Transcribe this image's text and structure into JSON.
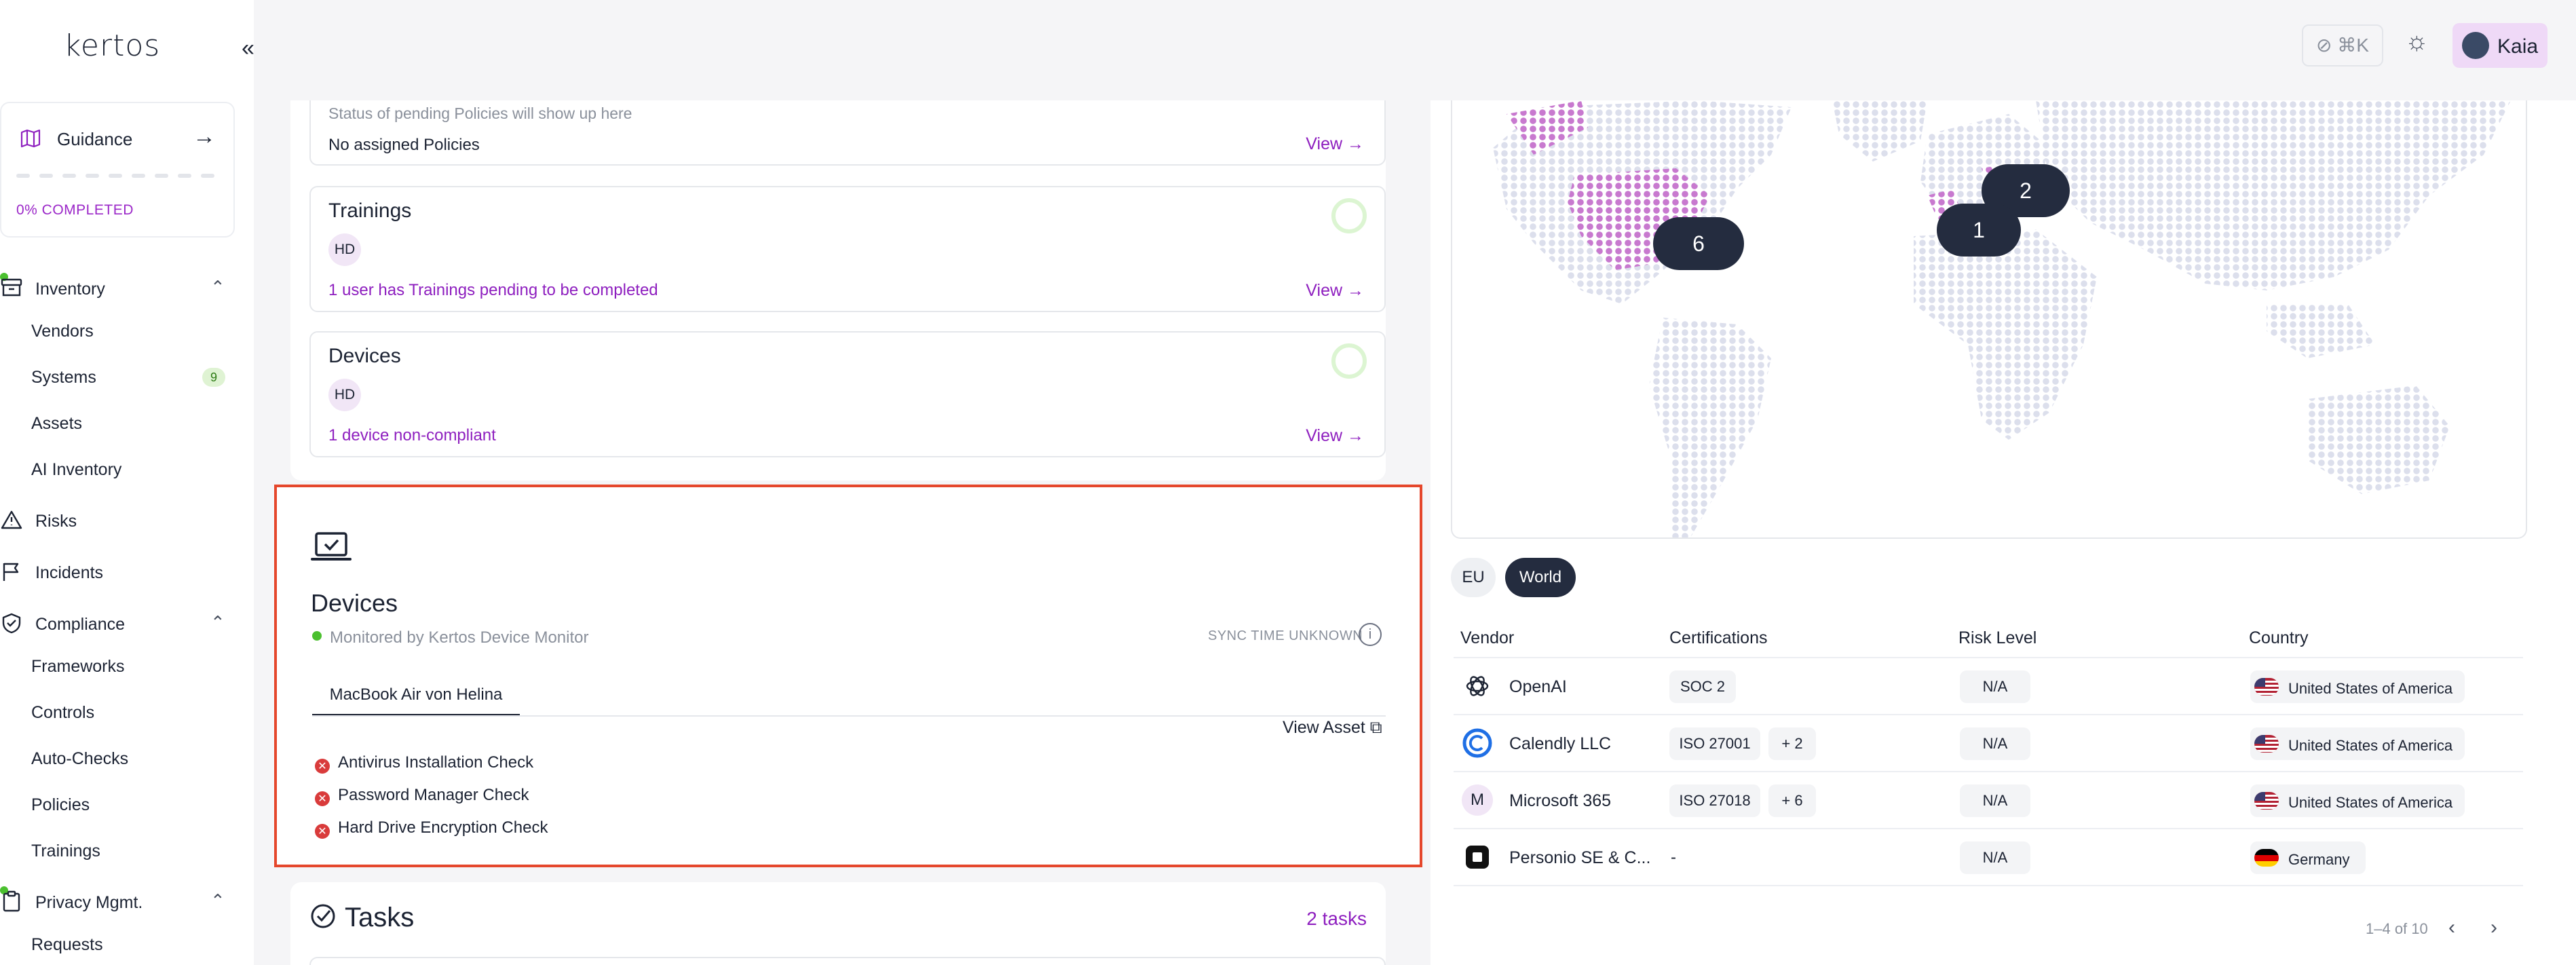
{
  "app": {
    "logo_text": "kertos"
  },
  "sidebar": {
    "guidance": {
      "title": "Guidance",
      "progress_label": "0% COMPLETED",
      "progress": 0
    },
    "groups": [
      {
        "label": "Inventory",
        "items": [
          "Vendors",
          "Systems",
          "Assets",
          "AI Inventory"
        ]
      },
      {
        "label": "Risks"
      },
      {
        "label": "Incidents"
      },
      {
        "label": "Compliance",
        "items": [
          "Frameworks",
          "Controls",
          "Auto-Checks",
          "Policies",
          "Trainings"
        ]
      },
      {
        "label": "Privacy Mgmt.",
        "items": [
          "Requests"
        ]
      }
    ],
    "systems_badge": "9"
  },
  "topbar": {
    "shortcut": "⌘K",
    "user_name": "Kaia"
  },
  "cards": {
    "policies": {
      "status_text": "Status of pending Policies will show up here",
      "message": "No assigned Policies",
      "view": "View"
    },
    "trainings": {
      "title": "Trainings",
      "initials": "HD",
      "message": "1 user has Trainings pending to be completed",
      "view": "View"
    },
    "devices": {
      "title": "Devices",
      "initials": "HD",
      "message": "1 device non-compliant",
      "view": "View"
    }
  },
  "device_monitor": {
    "title": "Devices",
    "monitored_by": "Monitored by Kertos Device Monitor",
    "sync": "SYNC TIME UNKNOWN",
    "tab": "MacBook Air von Helina",
    "view_asset": "View Asset",
    "checks": [
      "Antivirus Installation Check",
      "Password Manager Check",
      "Hard Drive Encryption Check"
    ]
  },
  "tasks": {
    "title": "Tasks",
    "count": "2 tasks"
  },
  "map": {
    "clusters": [
      "2",
      "1",
      "6"
    ],
    "toggle": {
      "eu": "EU",
      "world": "World"
    }
  },
  "vendors_table": {
    "headers": [
      "Vendor",
      "Certifications",
      "Risk Level",
      "Country"
    ],
    "rows": [
      {
        "vendor": "OpenAI",
        "certs": [
          "SOC 2"
        ],
        "risk": "N/A",
        "country": "United States of America"
      },
      {
        "vendor": "Calendly LLC",
        "certs": [
          "ISO 27001",
          "+ 2"
        ],
        "risk": "N/A",
        "country": "United States of America"
      },
      {
        "vendor": "Microsoft 365",
        "certs": [
          "ISO 27018",
          "+ 6"
        ],
        "risk": "N/A",
        "country": "United States of America",
        "logo_letter": "M"
      },
      {
        "vendor": "Personio SE & C...",
        "certs": [
          "-"
        ],
        "risk": "N/A",
        "country": "Germany"
      }
    ],
    "pagination": "1–4 of 10"
  },
  "colors": {
    "accent": "#8e1fbf",
    "dark": "#242c3f",
    "highlight_border": "#e5472c"
  }
}
